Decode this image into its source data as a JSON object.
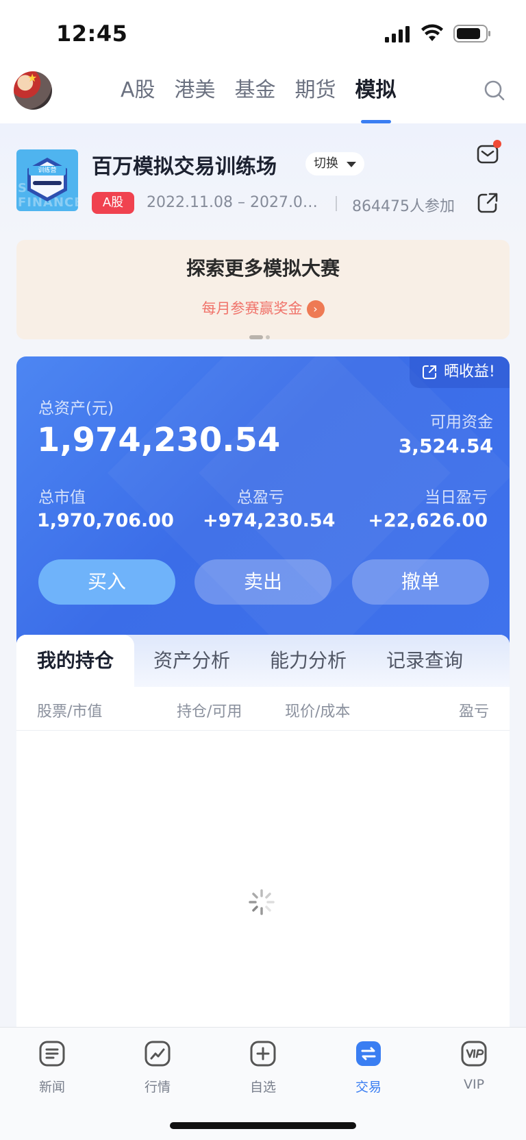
{
  "status_bar": {
    "time": "12:45"
  },
  "nav": {
    "tabs": [
      "A股",
      "港美",
      "基金",
      "期货",
      "模拟"
    ],
    "active_tab": "模拟"
  },
  "contest": {
    "logo_tag": "训练营",
    "logo_watermark": "SINA FINANCE",
    "title": "百万模拟交易训练场",
    "switch_label": "切换",
    "market_badge": "A股",
    "dates": "2022.11.08 – 2027.0…",
    "participants": "864475人参加"
  },
  "banner": {
    "heading": "探索更多模拟大赛",
    "subtitle": "每月参赛赢奖金"
  },
  "account": {
    "showoff_label": "晒收益!",
    "total_assets_label": "总资产(元)",
    "total_assets": "1,974,230.54",
    "available_label": "可用资金",
    "available": "3,524.54",
    "market_value_label": "总市值",
    "market_value": "1,970,706.00",
    "total_pnl_label": "总盈亏",
    "total_pnl": "+974,230.54",
    "daily_pnl_label": "当日盈亏",
    "daily_pnl": "+22,626.00",
    "buy_label": "买入",
    "sell_label": "卖出",
    "cancel_label": "撤单"
  },
  "positions": {
    "tabs": [
      "我的持仓",
      "资产分析",
      "能力分析",
      "记录查询"
    ],
    "columns": [
      "股票/市值",
      "持仓/可用",
      "现价/成本",
      "盈亏"
    ]
  },
  "bottom_nav": {
    "items": [
      "新闻",
      "行情",
      "自选",
      "交易",
      "VIP"
    ],
    "active": "交易"
  },
  "colors": {
    "accent": "#3a7ef2",
    "card_blue": "#3f72ec",
    "badge_red": "#f0424f",
    "banner_bg": "#f8efe6"
  }
}
